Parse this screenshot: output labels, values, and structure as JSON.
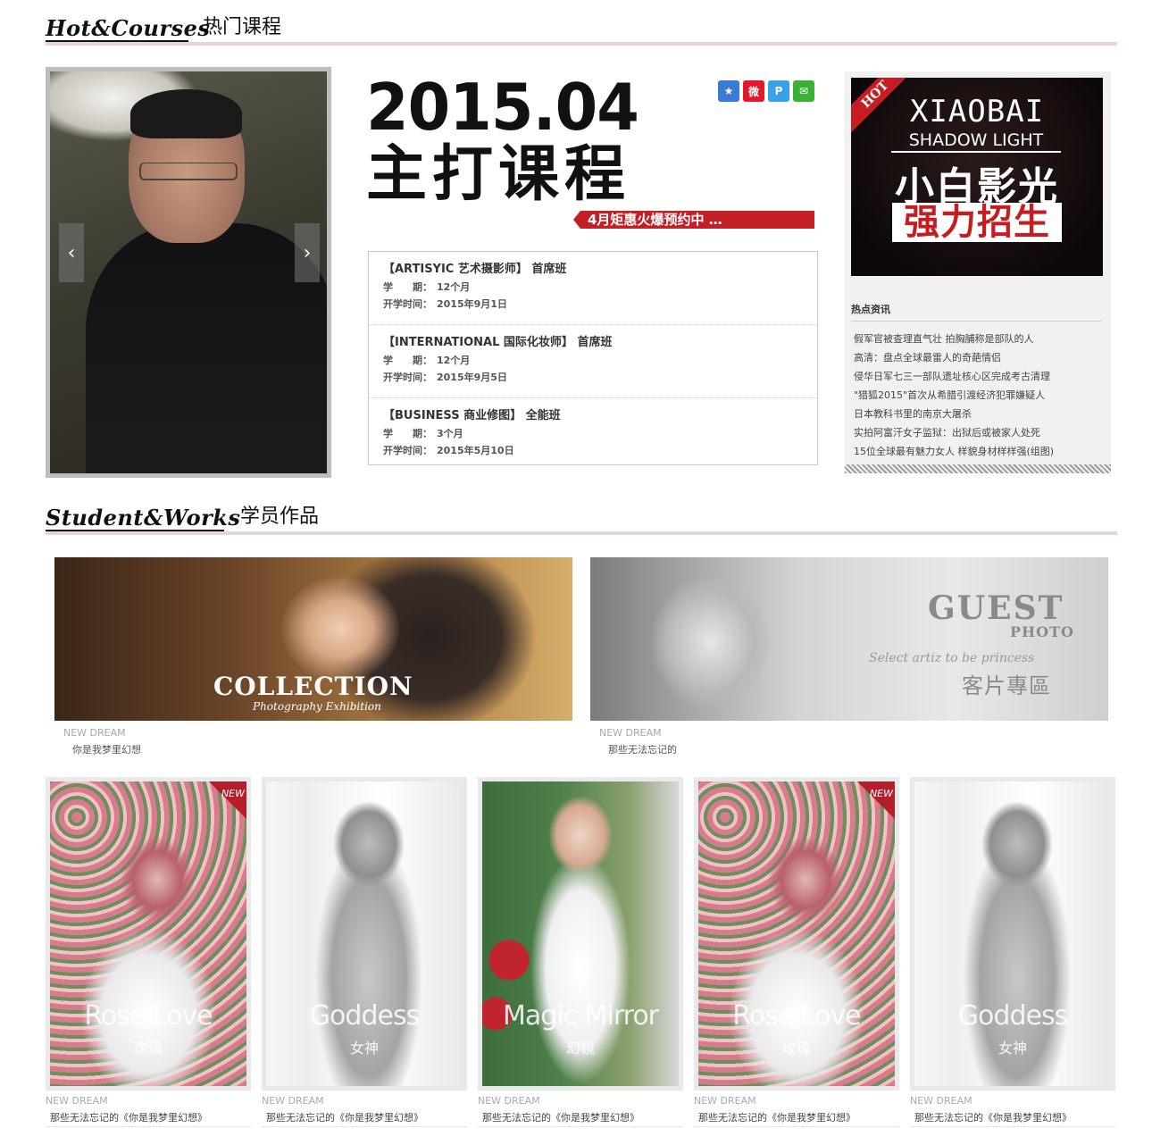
{
  "sections": {
    "hot": {
      "en": "Hot&Courses",
      "zh": "热门课程"
    },
    "works": {
      "en": "Student&Works",
      "zh": "学员作品"
    }
  },
  "slider": {
    "prev": "‹",
    "next": "›"
  },
  "banner": {
    "date": "2015.04",
    "title": "主打课程",
    "ribbon": "4月矩惠火爆预约中 …"
  },
  "share_icons": [
    {
      "name": "qzone-icon",
      "glyph": "★",
      "color": "#3a7bd5"
    },
    {
      "name": "weibo-icon",
      "glyph": "微",
      "color": "#e6162d"
    },
    {
      "name": "tencent-weibo-icon",
      "glyph": "P",
      "color": "#3aa0e8"
    },
    {
      "name": "wechat-icon",
      "glyph": "✉",
      "color": "#3cb034"
    }
  ],
  "courses": [
    {
      "title": "【ARTISYIC 艺术摄影师】 首席班",
      "term_label": "学　　期：",
      "term": "12个月",
      "start_label": "开学时间：",
      "start": "2015年9月1日"
    },
    {
      "title": "【INTERNATIONAL 国际化妆师】 首席班",
      "term_label": "学　　期：",
      "term": "12个月",
      "start_label": "开学时间：",
      "start": "2015年9月5日"
    },
    {
      "title": "【BUSINESS 商业修图】 全能班",
      "term_label": "学　　期：",
      "term": "3个月",
      "start_label": "开学时间：",
      "start": "2015年5月10日"
    }
  ],
  "hot_panel": {
    "tag": "HOT",
    "poster_line1": "XIAOBAI",
    "poster_line2": "SHADOW LIGHT",
    "poster_line3": "小白影光",
    "poster_line4": "强力招生",
    "news_title": "热点资讯",
    "news": [
      "假军官被查理直气壮 拍胸脯称是部队的人",
      "高清：盘点全球最雷人的奇葩情侣",
      "侵华日军七三一部队遗址核心区完成考古清理",
      "\"猎狐2015\"首次从希腊引渡经济犯罪嫌疑人",
      "日本教科书里的南京大屠杀",
      "实拍阿富汗女子监狱：出狱后或被家人处死",
      "15位全球最有魅力女人 样貌身材样样强(组图)"
    ]
  },
  "wide_works": [
    {
      "title": "COLLECTION",
      "subtitle": "Photography Exhibition",
      "cap_en": "NEW DREAM",
      "cap_zh": "你是我梦里幻想"
    },
    {
      "title": "GUEST",
      "title2": "PHOTO",
      "tagline": "Select artiz to be princess",
      "zh": "客片專區",
      "cap_en": "NEW DREAM",
      "cap_zh": "那些无法忘记的"
    }
  ],
  "cards": [
    {
      "style": "rose",
      "new": true,
      "new_label": "NEW",
      "ov_en": "Rose Love",
      "ov_zh": "玫瑰",
      "cap_en": "NEW DREAM",
      "cap_zh": "那些无法忘记的《你是我梦里幻想》"
    },
    {
      "style": "goddess",
      "new": false,
      "ov_en": "Goddess",
      "ov_zh": "女神",
      "cap_en": "NEW DREAM",
      "cap_zh": "那些无法忘记的《你是我梦里幻想》"
    },
    {
      "style": "magic",
      "new": false,
      "ov_en": "Magic Mirror",
      "ov_zh": "幻镜",
      "cap_en": "NEW DREAM",
      "cap_zh": "那些无法忘记的《你是我梦里幻想》"
    },
    {
      "style": "rose",
      "new": true,
      "new_label": "NEW",
      "ov_en": "Rose Love",
      "ov_zh": "玫瑰",
      "cap_en": "NEW DREAM",
      "cap_zh": "那些无法忘记的《你是我梦里幻想》"
    },
    {
      "style": "goddess",
      "new": false,
      "ov_en": "Goddess",
      "ov_zh": "女神",
      "cap_en": "NEW DREAM",
      "cap_zh": "那些无法忘记的《你是我梦里幻想》"
    }
  ],
  "colors": {
    "accent_red": "#c41e26",
    "divider": "#e8d4d4",
    "panel_bg": "#f1f1f1"
  }
}
